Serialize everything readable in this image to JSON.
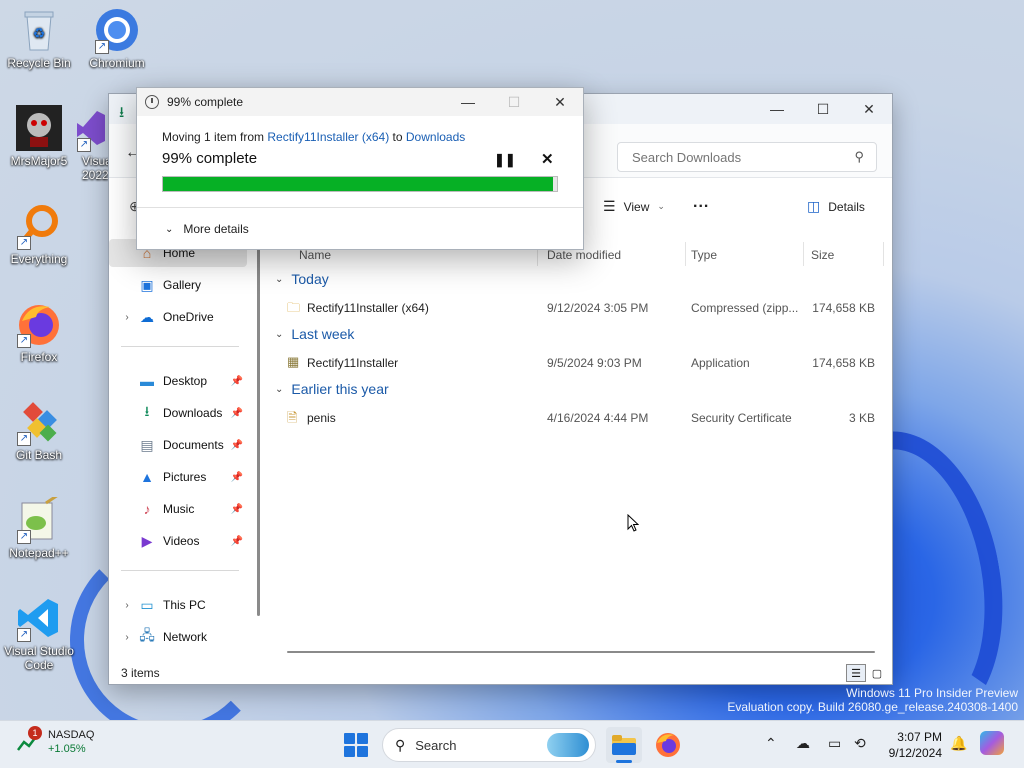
{
  "desktop": {
    "icons": [
      {
        "label": "Recycle Bin",
        "icon": "recycle-bin-icon"
      },
      {
        "label": "Chromium",
        "icon": "chromium-icon"
      },
      {
        "label": "MrsMajor5",
        "icon": "mrsmajor-icon"
      },
      {
        "label": "Visual 2022",
        "icon": "visual-studio-2022-icon"
      },
      {
        "label": "Everything",
        "icon": "everything-search-icon"
      },
      {
        "label": "Firefox",
        "icon": "firefox-icon"
      },
      {
        "label": "Git Bash",
        "icon": "git-bash-icon"
      },
      {
        "label": "Notepad++",
        "icon": "notepad-plus-plus-icon"
      },
      {
        "label": "Visual Studio Code",
        "icon": "vscode-icon"
      }
    ]
  },
  "progress_dialog": {
    "title": "99% complete",
    "moving_prefix": "Moving 1 item from ",
    "source": "Rectify11Installer (x64)",
    "to_word": " to ",
    "destination": "Downloads",
    "percent_text": "99% complete",
    "progress": 0.99,
    "more_details": "More details",
    "bar_color": "#06b025"
  },
  "explorer": {
    "search_placeholder": "Search Downloads",
    "toolbar": {
      "view_label": "View",
      "more_label": "...",
      "details_label": "Details"
    },
    "nav": {
      "home": "Home",
      "gallery": "Gallery",
      "onedrive": "OneDrive",
      "desktop": "Desktop",
      "downloads": "Downloads",
      "documents": "Documents",
      "pictures": "Pictures",
      "music": "Music",
      "videos": "Videos",
      "this_pc": "This PC",
      "network": "Network"
    },
    "columns": {
      "name": "Name",
      "date": "Date modified",
      "type": "Type",
      "size": "Size"
    },
    "groups": [
      {
        "label": "Today",
        "items": [
          {
            "name": "Rectify11Installer (x64)",
            "date": "9/12/2024 3:05 PM",
            "type": "Compressed (zipp...",
            "size": "174,658 KB",
            "icon": "zip-folder-icon"
          }
        ]
      },
      {
        "label": "Last week",
        "items": [
          {
            "name": "Rectify11Installer",
            "date": "9/5/2024 9:03 PM",
            "type": "Application",
            "size": "174,658 KB",
            "icon": "application-icon"
          }
        ]
      },
      {
        "label": "Earlier this year",
        "items": [
          {
            "name": "penis",
            "date": "4/16/2024 4:44 PM",
            "type": "Security Certificate",
            "size": "3 KB",
            "icon": "certificate-icon"
          }
        ]
      }
    ],
    "status_count": "3 items"
  },
  "watermark": {
    "line1": "Windows 11 Pro Insider Preview",
    "line2": "Evaluation copy. Build 26080.ge_release.240308-1400"
  },
  "taskbar": {
    "widget_name": "NASDAQ",
    "widget_change": "+1.05%",
    "widget_badge": "1",
    "search_label": "Search",
    "time": "3:07 PM",
    "date": "9/12/2024"
  }
}
